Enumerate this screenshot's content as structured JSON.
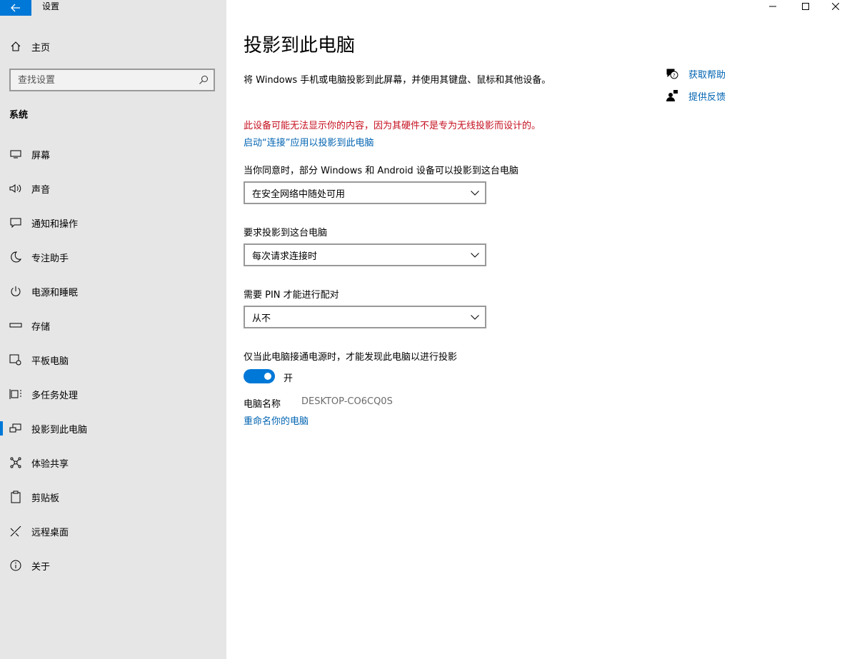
{
  "window": {
    "title": "设置",
    "controls": {
      "minimize": "minimize-icon",
      "maximize": "maximize-icon",
      "close": "close-icon"
    }
  },
  "sidebar": {
    "home_label": "主页",
    "search_placeholder": "查找设置",
    "section_title": "系统",
    "items": [
      {
        "label": "屏幕",
        "icon": "monitor-icon"
      },
      {
        "label": "声音",
        "icon": "speaker-icon"
      },
      {
        "label": "通知和操作",
        "icon": "notification-icon"
      },
      {
        "label": "专注助手",
        "icon": "moon-icon"
      },
      {
        "label": "电源和睡眠",
        "icon": "power-icon"
      },
      {
        "label": "存储",
        "icon": "storage-icon"
      },
      {
        "label": "平板电脑",
        "icon": "tablet-icon"
      },
      {
        "label": "多任务处理",
        "icon": "multitask-icon"
      },
      {
        "label": "投影到此电脑",
        "icon": "project-icon",
        "active": true
      },
      {
        "label": "体验共享",
        "icon": "share-icon"
      },
      {
        "label": "剪贴板",
        "icon": "clipboard-icon"
      },
      {
        "label": "远程桌面",
        "icon": "remote-icon"
      },
      {
        "label": "关于",
        "icon": "info-icon"
      }
    ]
  },
  "main": {
    "title": "投影到此电脑",
    "description": "将 Windows 手机或电脑投影到此屏幕，并使用其键盘、鼠标和其他设备。",
    "warning": "此设备可能无法显示你的内容，因为其硬件不是专为无线投影而设计的。",
    "launch_link": "启动“连接”应用以投影到此电脑",
    "availability": {
      "label": "当你同意时，部分 Windows 和 Android 设备可以投影到这台电脑",
      "value": "在安全网络中随处可用"
    },
    "ask_to_project": {
      "label": "要求投影到这台电脑",
      "value": "每次请求连接时"
    },
    "require_pin": {
      "label": "需要 PIN 才能进行配对",
      "value": "从不"
    },
    "power_only": {
      "label": "仅当此电脑接通电源时，才能发现此电脑以进行投影",
      "toggle_state": "开",
      "on": true
    },
    "pc_name": {
      "label": "电脑名称",
      "value": "DESKTOP-CO6CQ0S"
    },
    "rename_link": "重命名你的电脑"
  },
  "help": {
    "get_help": "获取帮助",
    "give_feedback": "提供反馈"
  },
  "colors": {
    "accent": "#0078d7",
    "link": "#0063b1",
    "warning": "#c50f1f",
    "sidebar_bg": "#e6e6e6"
  }
}
